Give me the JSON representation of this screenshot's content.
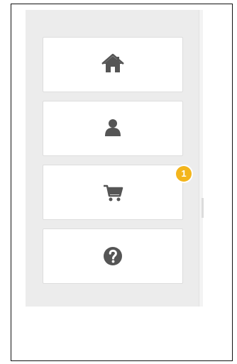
{
  "sidebar": {
    "items": [
      {
        "icon": "home-icon"
      },
      {
        "icon": "user-icon"
      },
      {
        "icon": "cart-icon",
        "badge_count": "1"
      },
      {
        "icon": "help-icon"
      }
    ]
  },
  "colors": {
    "icon": "#555555",
    "badge": "#f3b51c",
    "panel_background": "#ececec",
    "tile_background": "#ffffff"
  }
}
